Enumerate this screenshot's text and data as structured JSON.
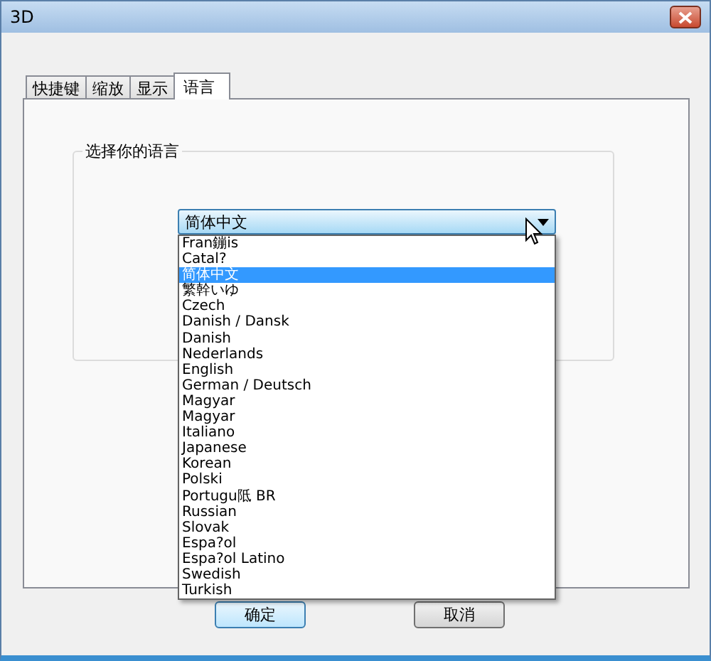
{
  "window": {
    "title": "3D"
  },
  "tabs": [
    {
      "label": "快捷键",
      "selected": false
    },
    {
      "label": "缩放",
      "selected": false
    },
    {
      "label": "显示",
      "selected": false
    },
    {
      "label": "语言",
      "selected": true
    }
  ],
  "group": {
    "title": "选择你的语言"
  },
  "language_select": {
    "value": "简体中文",
    "expanded": true,
    "options": [
      {
        "label": "Fran鏰is",
        "selected": false
      },
      {
        "label": "Catal?",
        "selected": false
      },
      {
        "label": "简体中文",
        "selected": true
      },
      {
        "label": "繁幹いゆ",
        "selected": false
      },
      {
        "label": "Czech",
        "selected": false
      },
      {
        "label": "Danish / Dansk",
        "selected": false
      },
      {
        "label": "Danish",
        "selected": false
      },
      {
        "label": "Nederlands",
        "selected": false
      },
      {
        "label": "English",
        "selected": false
      },
      {
        "label": "German / Deutsch",
        "selected": false
      },
      {
        "label": "Magyar",
        "selected": false
      },
      {
        "label": "Magyar",
        "selected": false
      },
      {
        "label": "Italiano",
        "selected": false
      },
      {
        "label": "Japanese",
        "selected": false
      },
      {
        "label": "Korean",
        "selected": false
      },
      {
        "label": "Polski",
        "selected": false
      },
      {
        "label": "Portugu阺 BR",
        "selected": false
      },
      {
        "label": "Russian",
        "selected": false
      },
      {
        "label": "Slovak",
        "selected": false
      },
      {
        "label": "Espa?ol",
        "selected": false
      },
      {
        "label": "Espa?ol Latino",
        "selected": false
      },
      {
        "label": "Swedish",
        "selected": false
      },
      {
        "label": "Turkish",
        "selected": false
      }
    ]
  },
  "buttons": [
    {
      "label": "确定",
      "default": true
    },
    {
      "label": "取消",
      "default": false
    }
  ]
}
